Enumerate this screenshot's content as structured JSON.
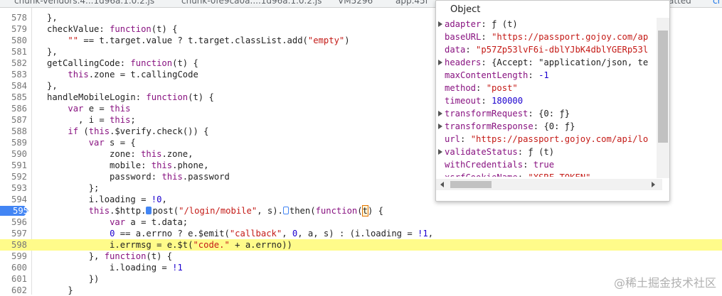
{
  "tabs": [
    {
      "label": "chunk-vendors.4...1d96a.1.0.2.js"
    },
    {
      "label": "chunk-0fe9ca0a....1d96a.1.0.2.js"
    },
    {
      "label": "VM5296"
    },
    {
      "label": "app.45f"
    },
    {
      "label": "atted"
    },
    {
      "label": "cr"
    }
  ],
  "code": {
    "lines": [
      {
        "num": "578",
        "text": "            },"
      },
      {
        "num": "579",
        "text": "            checkValue: function(t) {"
      },
      {
        "num": "580",
        "text": "                \"\" == t.target.value ? t.target.classList.add(\"empty\")"
      },
      {
        "num": "581",
        "text": "            },"
      },
      {
        "num": "582",
        "text": "            getCallingCode: function(t) {"
      },
      {
        "num": "583",
        "text": "                this.zone = t.callingCode"
      },
      {
        "num": "584",
        "text": "            },"
      },
      {
        "num": "585",
        "text": "            handleMobileLogin: function(t) {"
      },
      {
        "num": "586",
        "text": "                var e = this"
      },
      {
        "num": "587",
        "text": "                  , i = this;"
      },
      {
        "num": "588",
        "text": "                if (this.$verify.check()) {"
      },
      {
        "num": "589",
        "text": "                    var s = {"
      },
      {
        "num": "590",
        "text": "                        zone: this.zone,"
      },
      {
        "num": "591",
        "text": "                        mobile: this.phone,"
      },
      {
        "num": "592",
        "text": "                        password: this.password"
      },
      {
        "num": "593",
        "text": "                    };"
      },
      {
        "num": "594",
        "text": "                    i.loading = !0,"
      },
      {
        "num": "595",
        "text": "                    this.$http.post(\"/login/mobile\", s).then(function(t) {"
      },
      {
        "num": "596",
        "text": "                        var a = t.data;"
      },
      {
        "num": "597",
        "text": "                        0 == a.errno ? e.$emit(\"callback\", 0, a, s) : (i.loading = !1,"
      },
      {
        "num": "598",
        "text": "                        i.errmsg = e.$t(\"code.\" + a.errno))"
      },
      {
        "num": "599",
        "text": "                    }, function(t) {"
      },
      {
        "num": "600",
        "text": "                        i.loading = !1"
      },
      {
        "num": "601",
        "text": "                    })"
      },
      {
        "num": "602",
        "text": "                }"
      }
    ],
    "breakpoint_line": "595",
    "highlight_line": "598"
  },
  "popover": {
    "title": "Object",
    "props": [
      {
        "expandable": true,
        "name": "adapter",
        "value": "ƒ (t)"
      },
      {
        "expandable": false,
        "name": "baseURL",
        "value": "\"https://passport.gojoy.com/ap"
      },
      {
        "expandable": false,
        "name": "data",
        "value": "\"p57Zp53lvF6i-dblYJbK4dblYGERp53l"
      },
      {
        "expandable": true,
        "name": "headers",
        "value": "{Accept: \"application/json, te"
      },
      {
        "expandable": false,
        "name": "maxContentLength",
        "value": "-1"
      },
      {
        "expandable": false,
        "name": "method",
        "value": "\"post\""
      },
      {
        "expandable": false,
        "name": "timeout",
        "value": "180000"
      },
      {
        "expandable": true,
        "name": "transformRequest",
        "value": "{0: ƒ}"
      },
      {
        "expandable": true,
        "name": "transformResponse",
        "value": "{0: ƒ}"
      },
      {
        "expandable": false,
        "name": "url",
        "value": "\"https://passport.gojoy.com/api/lo"
      },
      {
        "expandable": true,
        "name": "validateStatus",
        "value": "ƒ (t)"
      },
      {
        "expandable": false,
        "name": "withCredentials",
        "value": "true"
      },
      {
        "expandable": false,
        "name": "xsrfCookieName",
        "value": "\"XSRF-TOKEN\""
      }
    ]
  },
  "watermark": "@稀土掘金技术社区",
  "colors": {
    "keyword": "#881280",
    "string": "#c41a16",
    "number": "#1c00cf",
    "breakpoint": "#4285f4",
    "highlight": "#fffb8a"
  }
}
